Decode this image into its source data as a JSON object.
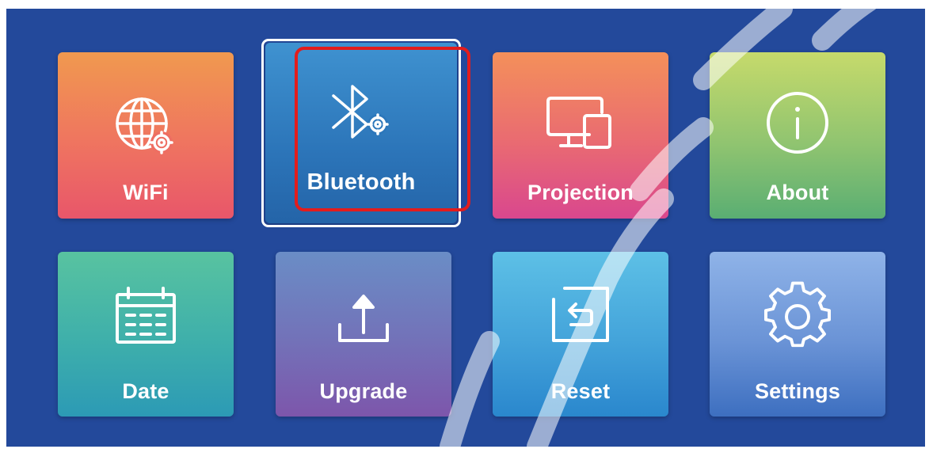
{
  "tiles": {
    "wifi": {
      "label": "WiFi",
      "icon": "globe-settings-icon",
      "gradient": [
        "#f0994f",
        "#e8566a"
      ]
    },
    "bluetooth": {
      "label": "Bluetooth",
      "icon": "bluetooth-settings-icon",
      "gradient": [
        "#3f8fce",
        "#2464a8"
      ],
      "selected": true
    },
    "projection": {
      "label": "Projection",
      "icon": "devices-icon",
      "gradient": [
        "#f4905a",
        "#d9478e"
      ]
    },
    "about": {
      "label": "About",
      "icon": "info-icon",
      "gradient": [
        "#c6da6b",
        "#5aae73"
      ]
    },
    "date": {
      "label": "Date",
      "icon": "calendar-icon",
      "gradient": [
        "#58c3a0",
        "#2c9ab5"
      ]
    },
    "upgrade": {
      "label": "Upgrade",
      "icon": "upload-icon",
      "gradient": [
        "#6a8dc6",
        "#7d56ab"
      ]
    },
    "reset": {
      "label": "Reset",
      "icon": "reset-icon",
      "gradient": [
        "#5dc0e6",
        "#2a87cd"
      ]
    },
    "settings": {
      "label": "Settings",
      "icon": "gear-icon",
      "gradient": [
        "#8fb3e8",
        "#3d6fc0"
      ]
    }
  },
  "colors": {
    "background": "#23499b",
    "focus_frame": "#ffffff",
    "highlight": "#e31c1c"
  }
}
